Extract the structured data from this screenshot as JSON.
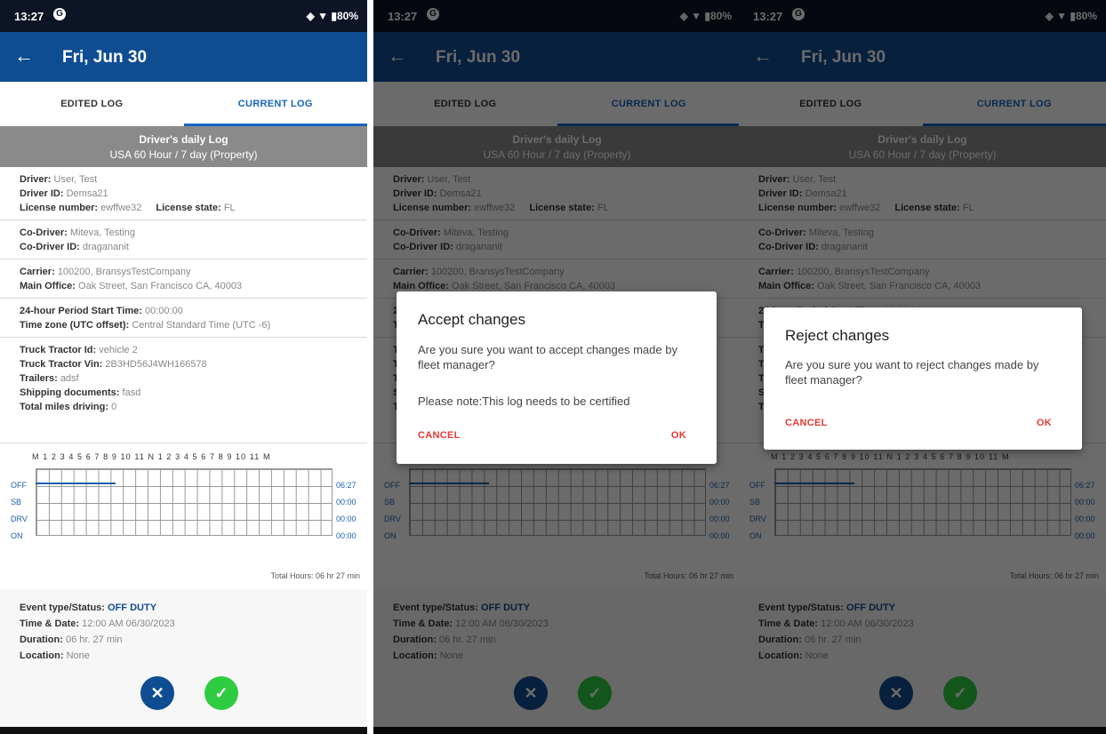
{
  "status_bar": {
    "time": "13:27",
    "app_icon": "G",
    "battery": "◈ ▼ ▮80%"
  },
  "app_bar": {
    "back_icon": "←",
    "title": "Fri, Jun 30"
  },
  "tabs": {
    "edited": "EDITED LOG",
    "current": "CURRENT LOG"
  },
  "log_header": {
    "title": "Driver's daily Log",
    "subtitle": "USA 60 Hour / 7 day (Property)"
  },
  "driver": {
    "driver_label": "Driver:",
    "driver_value": "User, Test",
    "id_label": "Driver ID:",
    "id_value": "Demsa21",
    "license_label": "License number:",
    "license_value": "ewffwe32",
    "state_label": "License state:",
    "state_value": "FL"
  },
  "codriver": {
    "label": "Co-Driver:",
    "value": "Miteva, Testing",
    "id_label": "Co-Driver ID:",
    "id_value": "dragananit"
  },
  "carrier": {
    "label": "Carrier:",
    "value": "100200, BransysTestCompany",
    "office_label": "Main Office:",
    "office_value": "Oak Street, San Francisco CA, 40003"
  },
  "period": {
    "start_label": "24-hour Period Start Time:",
    "start_value": "00:00:00",
    "tz_label": "Time zone (UTC offset):",
    "tz_value": "Central Standard Time (UTC -6)"
  },
  "vehicle": {
    "tractor_label": "Truck Tractor Id:",
    "tractor_value": "vehicle 2",
    "vin_label": "Truck Tractor Vin:",
    "vin_value": "2B3HD56J4WH166578",
    "trailers_label": "Trailers:",
    "trailers_value": "adsf",
    "docs_label": "Shipping documents:",
    "docs_value": "fasd",
    "miles_label": "Total miles driving:",
    "miles_value": "0"
  },
  "graph": {
    "hour_labels": "M 1 2 3 4 5 6 7 8 9 10 11 N 1 2 3 4 5 6 7 8 9 10 11 M",
    "rows": [
      "OFF",
      "SB",
      "DRV",
      "ON"
    ],
    "times": [
      "06:27",
      "00:00",
      "00:00",
      "00:00"
    ],
    "total": "Total Hours: 06 hr 27 min",
    "off_duty_fraction_of_day": 0.27
  },
  "event": {
    "type_label": "Event type/Status:",
    "type_value": "OFF DUTY",
    "time_label": "Time & Date:",
    "time_value": "12:00 AM 06/30/2023",
    "duration_label": "Duration:",
    "duration_value": "06 hr. 27 min",
    "location_label": "Location:",
    "location_value": "None"
  },
  "fab": {
    "reject": "✕",
    "accept": "✓"
  },
  "dialog_accept": {
    "title": "Accept changes",
    "message": "Are you sure you want to accept changes made by fleet manager?",
    "note": "Please note:This log needs to be certified",
    "cancel": "CANCEL",
    "ok": "OK"
  },
  "dialog_reject": {
    "title": "Reject changes",
    "message": "Are you sure you want to reject changes made by fleet manager?",
    "cancel": "CANCEL",
    "ok": "OK"
  }
}
